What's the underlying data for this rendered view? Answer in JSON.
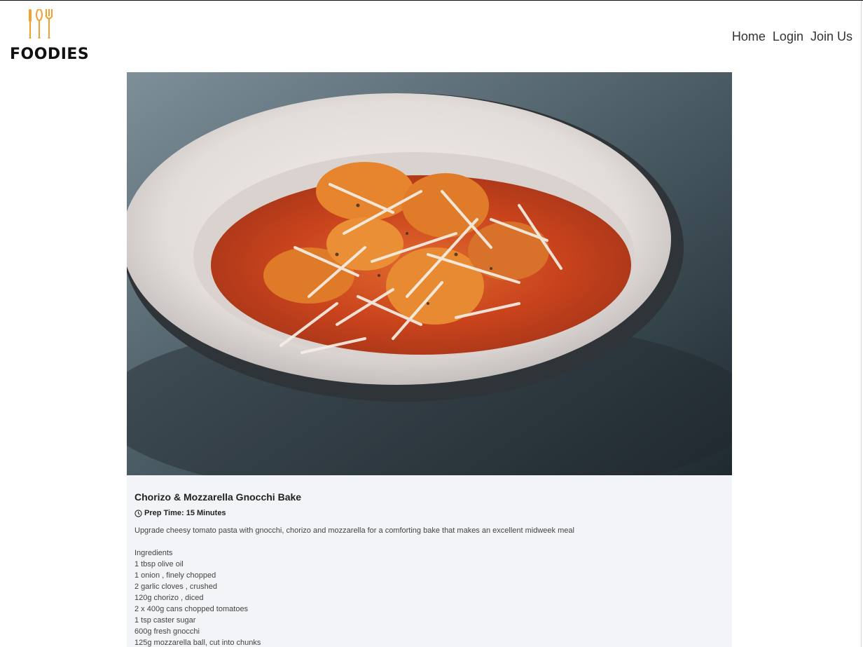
{
  "brand": {
    "logo_text": "FOODIES",
    "logo_icon": "cutlery-icon",
    "accent_color": "#f0a12e"
  },
  "nav": {
    "items": [
      {
        "label": "Home"
      },
      {
        "label": "Login"
      },
      {
        "label": "Join Us"
      }
    ]
  },
  "hero": {
    "image_subject": "gnocchi-bake-photo"
  },
  "recipe": {
    "title": "Chorizo & Mozzarella Gnocchi Bake",
    "prep_icon": "clock-icon",
    "prep_time": "Prep Time: 15 Minutes",
    "description": "Upgrade cheesy tomato pasta with gnocchi, chorizo and mozzarella for a comforting bake that makes an excellent midweek meal",
    "ingredients_heading": "Ingredients",
    "ingredients": [
      "1 tbsp olive oil",
      "1 onion , finely chopped",
      "2 garlic cloves , crushed",
      "120g chorizo , diced",
      "2 x 400g cans chopped tomatoes",
      "1 tsp caster sugar",
      "600g fresh gnocchi",
      "125g mozzarella ball, cut into chunks"
    ]
  }
}
